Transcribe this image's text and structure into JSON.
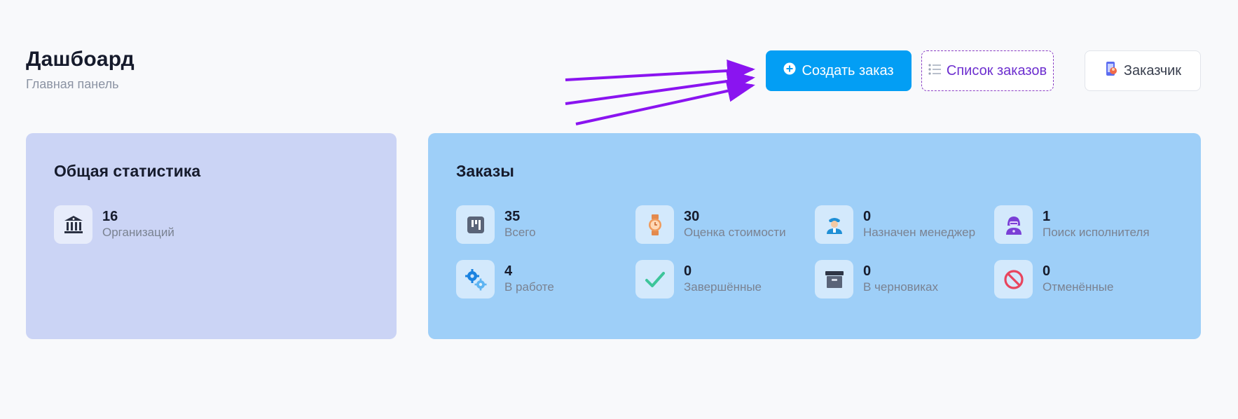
{
  "header": {
    "title": "Дашбоард",
    "subtitle": "Главная панель"
  },
  "actions": {
    "create_order": "Создать заказ",
    "order_list": "Список заказов",
    "customer": "Заказчик"
  },
  "general_stats": {
    "title": "Общая статистика",
    "items": [
      {
        "value": "16",
        "label": "Организаций",
        "icon": "bank-icon"
      }
    ]
  },
  "orders": {
    "title": "Заказы",
    "items": [
      {
        "value": "35",
        "label": "Всего",
        "icon": "board-icon"
      },
      {
        "value": "30",
        "label": "Оценка стоимости",
        "icon": "watch-icon"
      },
      {
        "value": "0",
        "label": "Назначен менеджер",
        "icon": "manager-icon"
      },
      {
        "value": "1",
        "label": "Поиск исполнителя",
        "icon": "hooded-user-icon"
      },
      {
        "value": "4",
        "label": "В работе",
        "icon": "gears-icon"
      },
      {
        "value": "0",
        "label": "Завершённые",
        "icon": "checkmark-icon"
      },
      {
        "value": "0",
        "label": "В черновиках",
        "icon": "archive-box-icon"
      },
      {
        "value": "0",
        "label": "Отменённые",
        "icon": "prohibited-icon"
      }
    ]
  },
  "colors": {
    "primary": "#039ef4",
    "list_accent": "#6d2fcf",
    "stats_card_bg": "#cbd4f5",
    "orders_card_bg": "#9ecff8",
    "arrow": "#8a14f0"
  }
}
